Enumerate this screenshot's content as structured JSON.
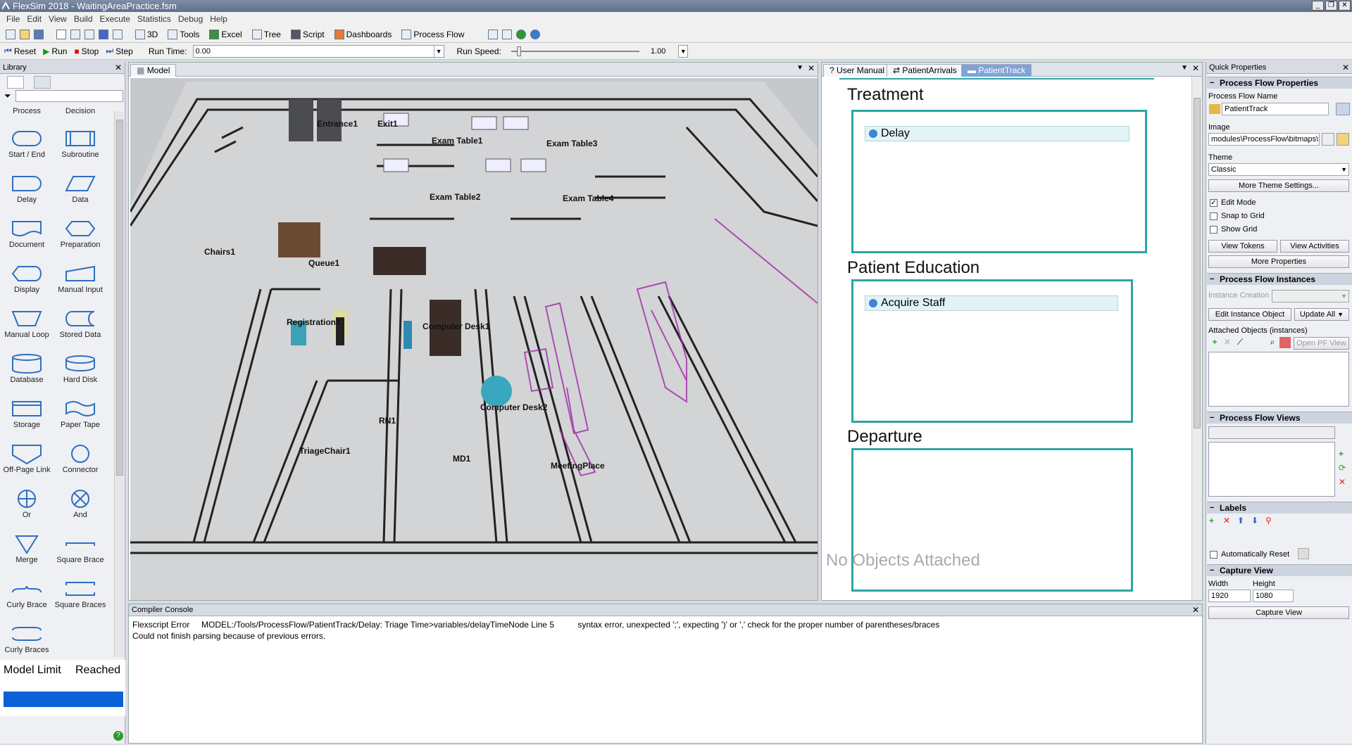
{
  "window": {
    "title": "FlexSim 2018 - WaitingAreaPractice.fsm"
  },
  "menu": [
    "File",
    "Edit",
    "View",
    "Build",
    "Execute",
    "Statistics",
    "Debug",
    "Help"
  ],
  "toolbar": {
    "btn_3d": "3D",
    "tools": "Tools",
    "excel": "Excel",
    "tree": "Tree",
    "script": "Script",
    "dashboards": "Dashboards",
    "process_flow": "Process Flow"
  },
  "run_bar": {
    "reset": "Reset",
    "run": "Run",
    "stop": "Stop",
    "step": "Step",
    "run_time_label": "Run Time:",
    "run_time_value": "0.00",
    "run_speed_label": "Run Speed:",
    "run_speed_value": "1.00"
  },
  "library": {
    "title": "Library",
    "partial_top": [
      "Process",
      "Decision"
    ],
    "shapes": [
      {
        "label": "Start / End",
        "icon": "rounded-rect"
      },
      {
        "label": "Subroutine",
        "icon": "subroutine"
      },
      {
        "label": "Delay",
        "icon": "delay"
      },
      {
        "label": "Data",
        "icon": "parallelogram"
      },
      {
        "label": "Document",
        "icon": "document"
      },
      {
        "label": "Preparation",
        "icon": "hexagon"
      },
      {
        "label": "Display",
        "icon": "display"
      },
      {
        "label": "Manual Input",
        "icon": "manual-input"
      },
      {
        "label": "Manual Loop",
        "icon": "trapezoid"
      },
      {
        "label": "Stored Data",
        "icon": "stored-data"
      },
      {
        "label": "Database",
        "icon": "cylinder"
      },
      {
        "label": "Hard Disk",
        "icon": "hard-disk"
      },
      {
        "label": "Storage",
        "icon": "storage"
      },
      {
        "label": "Paper Tape",
        "icon": "paper-tape"
      },
      {
        "label": "Off-Page Link",
        "icon": "pentagon"
      },
      {
        "label": "Connector",
        "icon": "circle"
      },
      {
        "label": "Or",
        "icon": "circle-plus"
      },
      {
        "label": "And",
        "icon": "circle-x"
      },
      {
        "label": "Merge",
        "icon": "triangle"
      },
      {
        "label": "Square Brace",
        "icon": "square-brace"
      },
      {
        "label": "Curly Brace",
        "icon": "curly-brace"
      },
      {
        "label": "Square Braces",
        "icon": "square-braces"
      },
      {
        "label": "Curly Braces",
        "icon": "curly-braces"
      }
    ],
    "model_limit": "Model Limit",
    "reached": "Reached",
    "accent": "#0b62d6"
  },
  "model": {
    "tab": "Model",
    "objects": [
      "Entrance1",
      "Exit1",
      "Exam Table1",
      "Exam Table3",
      "Exam Table2",
      "Exam Table4",
      "Chairs1",
      "Queue1",
      "Registration1",
      "Computer Desk1",
      "Computer Desk2",
      "RN1",
      "TriageChair1",
      "MD1",
      "MeetingPlace"
    ]
  },
  "process_flow": {
    "tabs": [
      "User Manual",
      "PatientArrivals",
      "PatientTrack"
    ],
    "sections": [
      {
        "title": "Treatment",
        "activity": "Delay"
      },
      {
        "title": "Patient Education",
        "activity": "Acquire Staff"
      },
      {
        "title": "Departure",
        "activity": ""
      }
    ],
    "no_objects": "No Objects Attached",
    "accent": "#2ea3a3"
  },
  "quick_properties": {
    "title": "Quick Properties",
    "pf_props": "Process Flow Properties",
    "pf_name_label": "Process Flow Name",
    "pf_name": "PatientTrack",
    "image_label": "Image",
    "image_value": "modules\\ProcessFlow\\bitmaps\\t",
    "theme_label": "Theme",
    "theme_value": "Classic",
    "more_theme": "More Theme Settings...",
    "edit_mode": "Edit Mode",
    "snap_grid": "Snap to Grid",
    "show_grid": "Show Grid",
    "view_tokens": "View Tokens",
    "view_activities": "View Activities",
    "more_props": "More Properties",
    "instances": "Process Flow Instances",
    "instance_creation": "Instance Creation",
    "edit_instance": "Edit Instance Object",
    "update_all": "Update All",
    "attached": "Attached Objects (instances)",
    "open_pf_view": "Open PF View",
    "views": "Process Flow Views",
    "labels": "Labels",
    "auto_reset": "Automatically Reset",
    "capture": "Capture View",
    "width_label": "Width",
    "width": "1920",
    "height_label": "Height",
    "height": "1080",
    "capture_btn": "Capture View"
  },
  "console": {
    "title": "Compiler Console",
    "line1": "Flexscript Error     MODEL:/Tools/ProcessFlow/PatientTrack/Delay: Triage Time>variables/delayTimeNode Line 5          syntax error, unexpected ';', expecting ')' or ',' check for the proper number of parentheses/braces",
    "line2": "Could not finish parsing because of previous errors."
  }
}
